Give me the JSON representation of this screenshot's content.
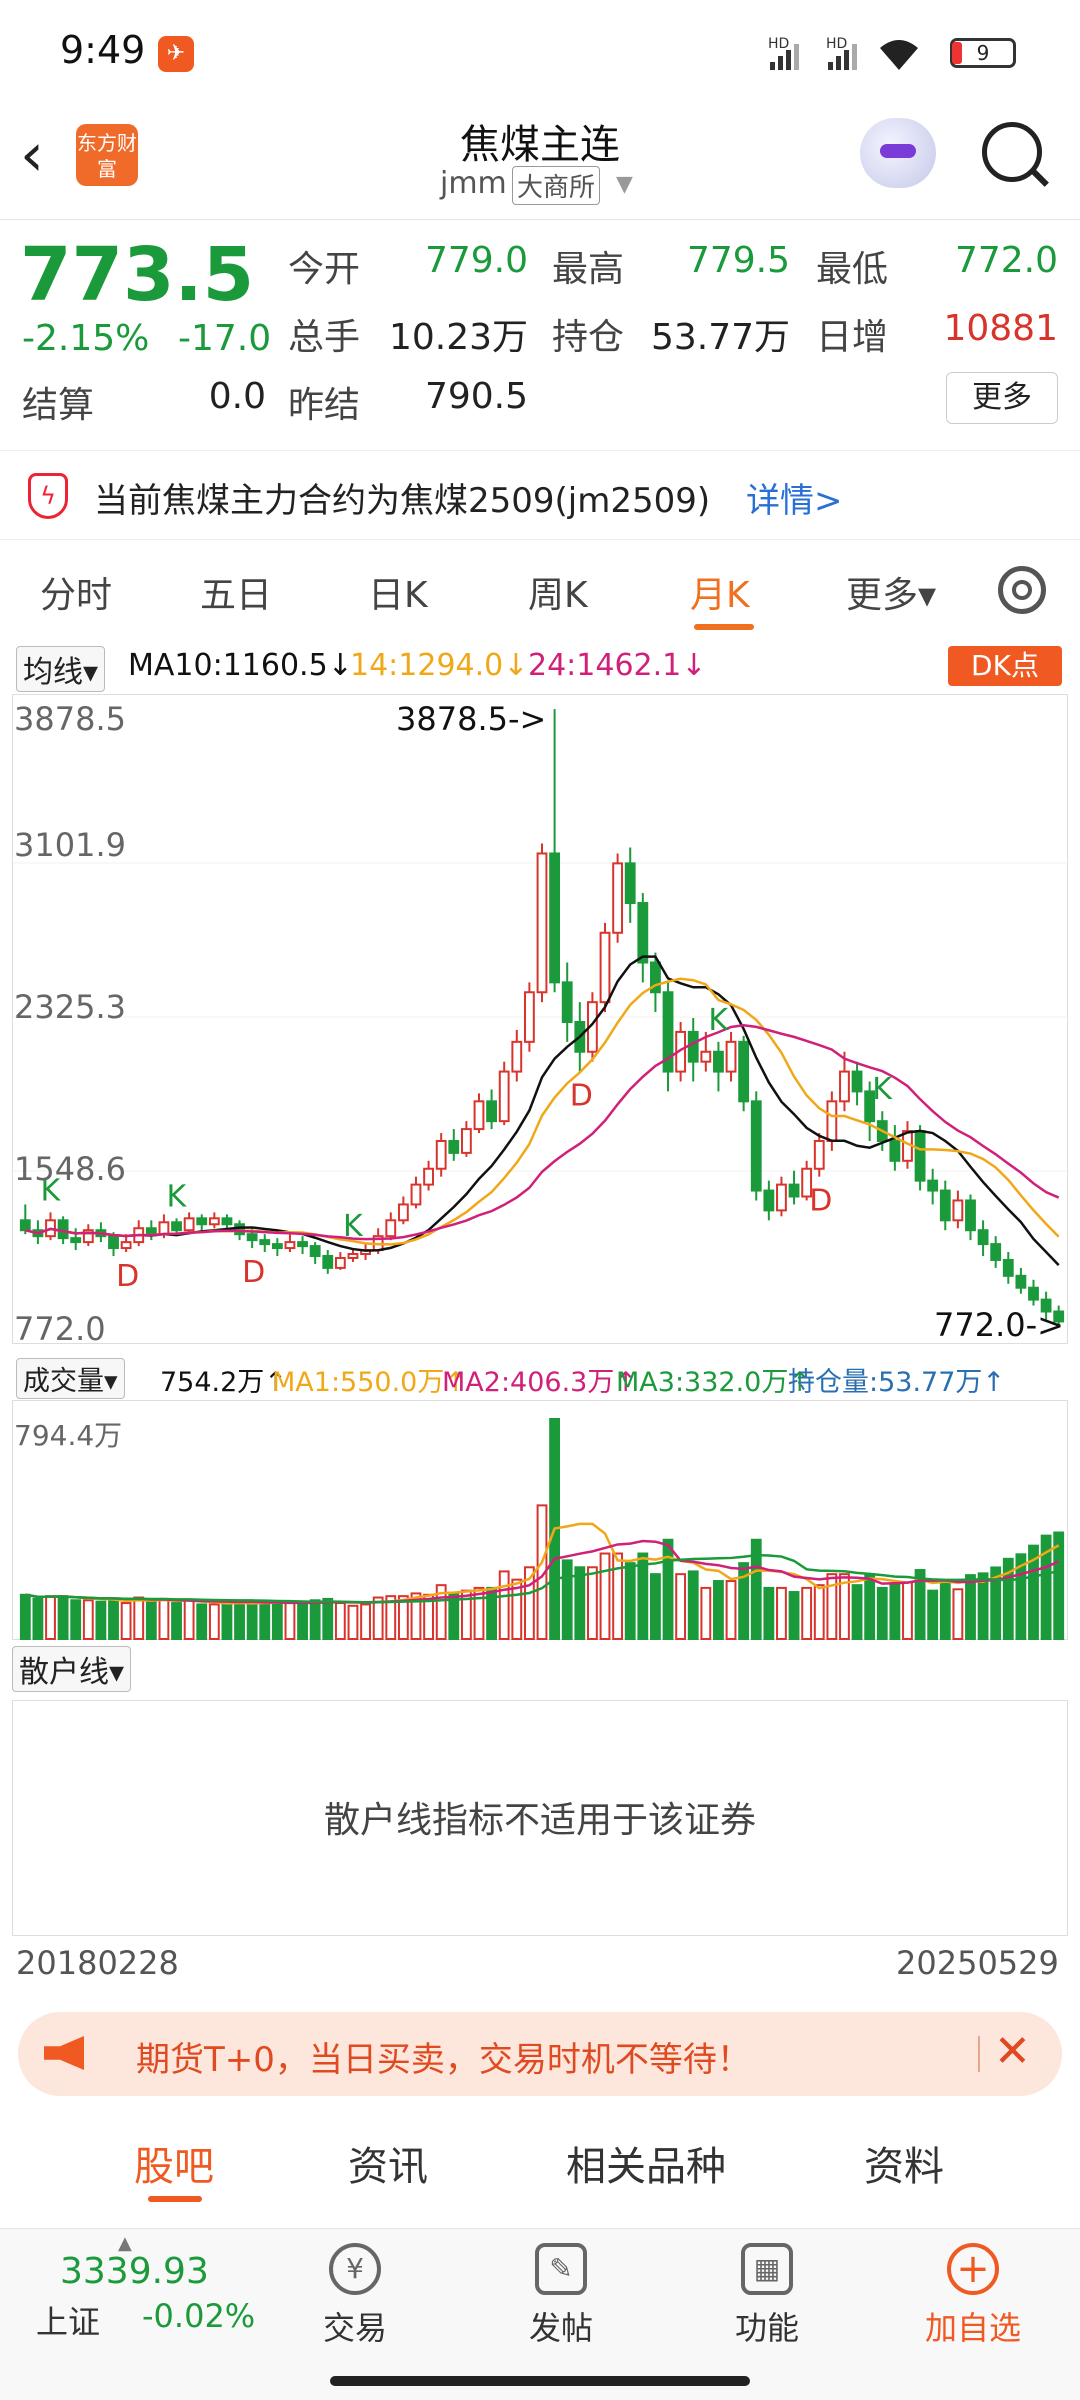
{
  "status": {
    "time": "9:49",
    "battery": "9",
    "net1": "HD",
    "net2": "HD"
  },
  "header": {
    "back": "‹",
    "logo": "东方财富",
    "title": "焦煤主连",
    "code": "jmm",
    "exchange": "大商所"
  },
  "quote": {
    "price": "773.5",
    "change_pct": "-2.15%",
    "change": "-17.0",
    "fields": [
      {
        "label": "今开",
        "value": "779.0",
        "color": "green"
      },
      {
        "label": "最高",
        "value": "779.5",
        "color": "green"
      },
      {
        "label": "最低",
        "value": "772.0",
        "color": "green"
      },
      {
        "label": "总手",
        "value": "10.23万",
        "color": "dark"
      },
      {
        "label": "持仓",
        "value": "53.77万",
        "color": "dark"
      },
      {
        "label": "日增",
        "value": "10881",
        "color": "red"
      },
      {
        "label": "结算",
        "value": "0.0",
        "color": "dark"
      },
      {
        "label": "昨结",
        "value": "790.5",
        "color": "dark"
      }
    ],
    "more": "更多"
  },
  "notice": {
    "text": "当前焦煤主力合约为焦煤2509(jm2509)",
    "link": "详情>"
  },
  "tabs": [
    "分时",
    "五日",
    "日K",
    "周K",
    "月K",
    "更多▾"
  ],
  "active_tab": "月K",
  "ma": {
    "selector": "均线▾",
    "ma10": "MA10:1160.5↓",
    "ma14": "14:1294.0↓",
    "ma24": "24:1462.1↓",
    "dk": "DK点"
  },
  "colors": {
    "up": "#d8342c",
    "down": "#1a9a3a",
    "ma10": "#111111",
    "ma14": "#f0a818",
    "ma24": "#d0207a",
    "accent": "#f05a22"
  },
  "chart_data": {
    "type": "candlestick",
    "y_ticks": [
      "3878.5",
      "3101.9",
      "2325.3",
      "1548.6",
      "772.0"
    ],
    "ylim": [
      772.0,
      3878.5
    ],
    "x_start": "20180228",
    "x_end": "20250529",
    "annotations": {
      "high": "3878.5->",
      "low": "772.0->"
    },
    "signals": [
      "K",
      "D",
      "K",
      "D",
      "K",
      "D",
      "K",
      "D",
      "K"
    ],
    "candles": [
      [
        1300,
        1250,
        1380,
        1230
      ],
      [
        1250,
        1220,
        1300,
        1180
      ],
      [
        1220,
        1300,
        1340,
        1200
      ],
      [
        1300,
        1210,
        1320,
        1180
      ],
      [
        1210,
        1190,
        1260,
        1150
      ],
      [
        1190,
        1250,
        1280,
        1170
      ],
      [
        1250,
        1220,
        1290,
        1190
      ],
      [
        1220,
        1160,
        1240,
        1120
      ],
      [
        1160,
        1190,
        1230,
        1140
      ],
      [
        1190,
        1260,
        1300,
        1170
      ],
      [
        1260,
        1230,
        1300,
        1200
      ],
      [
        1230,
        1290,
        1330,
        1210
      ],
      [
        1290,
        1250,
        1310,
        1220
      ],
      [
        1250,
        1310,
        1340,
        1230
      ],
      [
        1310,
        1280,
        1330,
        1250
      ],
      [
        1280,
        1310,
        1340,
        1260
      ],
      [
        1310,
        1280,
        1330,
        1250
      ],
      [
        1280,
        1230,
        1300,
        1200
      ],
      [
        1230,
        1200,
        1260,
        1160
      ],
      [
        1200,
        1180,
        1230,
        1140
      ],
      [
        1180,
        1160,
        1210,
        1120
      ],
      [
        1160,
        1190,
        1230,
        1140
      ],
      [
        1190,
        1170,
        1220,
        1130
      ],
      [
        1170,
        1120,
        1190,
        1080
      ],
      [
        1120,
        1060,
        1150,
        1030
      ],
      [
        1060,
        1110,
        1140,
        1050
      ],
      [
        1110,
        1130,
        1160,
        1090
      ],
      [
        1130,
        1150,
        1180,
        1100
      ],
      [
        1150,
        1220,
        1260,
        1130
      ],
      [
        1220,
        1300,
        1340,
        1200
      ],
      [
        1300,
        1380,
        1420,
        1280
      ],
      [
        1380,
        1480,
        1520,
        1360
      ],
      [
        1480,
        1560,
        1600,
        1450
      ],
      [
        1560,
        1700,
        1740,
        1520
      ],
      [
        1700,
        1640,
        1760,
        1600
      ],
      [
        1640,
        1760,
        1800,
        1620
      ],
      [
        1760,
        1900,
        1940,
        1740
      ],
      [
        1900,
        1800,
        1960,
        1760
      ],
      [
        1800,
        2050,
        2100,
        1780
      ],
      [
        2050,
        2200,
        2260,
        2000
      ],
      [
        2200,
        2450,
        2500,
        2150
      ],
      [
        2450,
        3150,
        3200,
        2400
      ],
      [
        3150,
        2500,
        3878,
        2450
      ],
      [
        2500,
        2300,
        2600,
        2200
      ],
      [
        2300,
        2150,
        2400,
        2050
      ],
      [
        2150,
        2400,
        2450,
        2100
      ],
      [
        2400,
        2750,
        2800,
        2350
      ],
      [
        2750,
        3100,
        3150,
        2700
      ],
      [
        3100,
        2900,
        3180,
        2800
      ],
      [
        2900,
        2600,
        2950,
        2500
      ],
      [
        2600,
        2450,
        2650,
        2350
      ],
      [
        2450,
        2050,
        2500,
        1950
      ],
      [
        2050,
        2250,
        2300,
        2000
      ],
      [
        2250,
        2100,
        2320,
        2000
      ],
      [
        2100,
        2150,
        2250,
        2050
      ],
      [
        2150,
        2050,
        2200,
        1950
      ],
      [
        2050,
        2200,
        2250,
        2000
      ],
      [
        2200,
        1900,
        2230,
        1850
      ],
      [
        1900,
        1450,
        1950,
        1400
      ],
      [
        1450,
        1350,
        1500,
        1300
      ],
      [
        1350,
        1480,
        1520,
        1320
      ],
      [
        1480,
        1420,
        1550,
        1380
      ],
      [
        1420,
        1560,
        1600,
        1400
      ],
      [
        1560,
        1700,
        1740,
        1520
      ],
      [
        1700,
        1900,
        1950,
        1650
      ],
      [
        1900,
        2050,
        2150,
        1850
      ],
      [
        2050,
        1950,
        2100,
        1880
      ],
      [
        1950,
        1800,
        2000,
        1700
      ],
      [
        1800,
        1700,
        1850,
        1650
      ],
      [
        1700,
        1600,
        1780,
        1550
      ],
      [
        1600,
        1750,
        1800,
        1560
      ],
      [
        1750,
        1500,
        1780,
        1450
      ],
      [
        1500,
        1450,
        1560,
        1380
      ],
      [
        1450,
        1300,
        1500,
        1250
      ],
      [
        1300,
        1400,
        1450,
        1260
      ],
      [
        1400,
        1250,
        1430,
        1200
      ],
      [
        1250,
        1180,
        1300,
        1120
      ],
      [
        1180,
        1100,
        1220,
        1060
      ],
      [
        1100,
        1020,
        1140,
        980
      ],
      [
        1020,
        960,
        1060,
        930
      ],
      [
        960,
        900,
        1000,
        870
      ],
      [
        900,
        840,
        940,
        800
      ],
      [
        840,
        790,
        870,
        770
      ]
    ],
    "volume": {
      "label": "成交量▾",
      "value": "754.2万↑",
      "ma1": "MA1:550.0万↑",
      "ma2": "MA2:406.3万↑",
      "ma3": "MA3:332.0万↑",
      "oi": "持仓量:53.77万↑",
      "max_label": "794.4万"
    }
  },
  "sanhu": {
    "selector": "散户线▾",
    "message": "散户线指标不适用于该证券"
  },
  "promo": {
    "text": "期货T+0，当日买卖，交易时机不等待！",
    "close": "✕"
  },
  "bottom_tabs": [
    "股吧",
    "资讯",
    "相关品种",
    "资料"
  ],
  "bottom_nav": {
    "index_value": "3339.93",
    "index_name": "上证",
    "index_change": "-0.02%",
    "items": [
      {
        "label": "交易",
        "icon": "¥"
      },
      {
        "label": "发帖",
        "icon": "✎"
      },
      {
        "label": "功能",
        "icon": "▦"
      },
      {
        "label": "加自选",
        "icon": "+"
      }
    ]
  }
}
